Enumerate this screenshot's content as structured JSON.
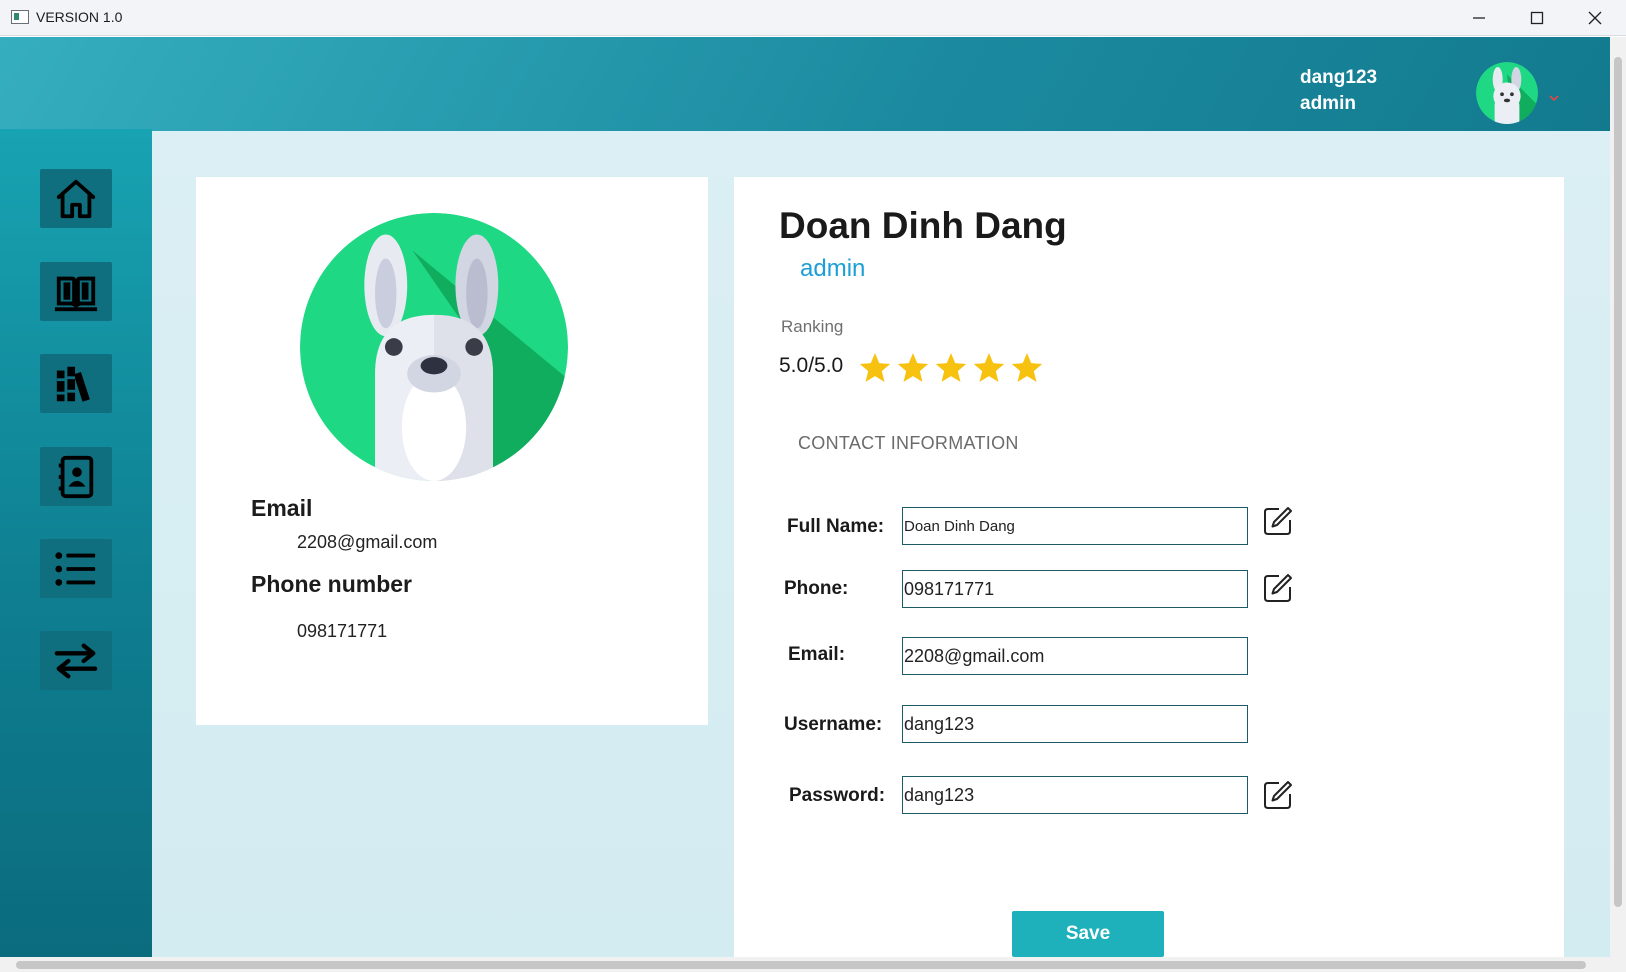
{
  "window": {
    "title": "VERSION 1.0",
    "controls": [
      "minimize",
      "maximize",
      "close"
    ]
  },
  "header": {
    "username": "dang123",
    "role": "admin",
    "avatar_icon": "rabbit-avatar-icon",
    "menu_icon": "chevron-down-icon"
  },
  "sidebar": {
    "items": [
      {
        "name": "home",
        "icon": "home-icon"
      },
      {
        "name": "books",
        "icon": "book-icon"
      },
      {
        "name": "library",
        "icon": "library-icon"
      },
      {
        "name": "contacts",
        "icon": "contact-book-icon"
      },
      {
        "name": "list",
        "icon": "list-icon"
      },
      {
        "name": "transfer",
        "icon": "swap-arrows-icon"
      }
    ]
  },
  "profile_card": {
    "email_heading": "Email",
    "email_value": "2208@gmail.com",
    "phone_heading": "Phone number",
    "phone_value": "098171771"
  },
  "details": {
    "full_name": "Doan Dinh Dang",
    "role": "admin",
    "ranking_label": "Ranking",
    "score": "5.0/5.0",
    "stars": 5,
    "star_color": "#f7c20f",
    "section_title": "CONTACT INFORMATION"
  },
  "form": {
    "full_name_label": "Full Name:",
    "full_name_value": "Doan Dinh Dang",
    "phone_label": "Phone:",
    "phone_value": "098171771",
    "email_label": "Email:",
    "email_value": "2208@gmail.com",
    "username_label": "Username:",
    "username_value": "dang123",
    "password_label": "Password:",
    "password_value": "dang123",
    "save_label": "Save"
  },
  "colors": {
    "accent": "#1eb1bc",
    "role": "#1a9fd6",
    "sidebar_button": "#0f6f7f",
    "input_border": "#1d5a68"
  }
}
